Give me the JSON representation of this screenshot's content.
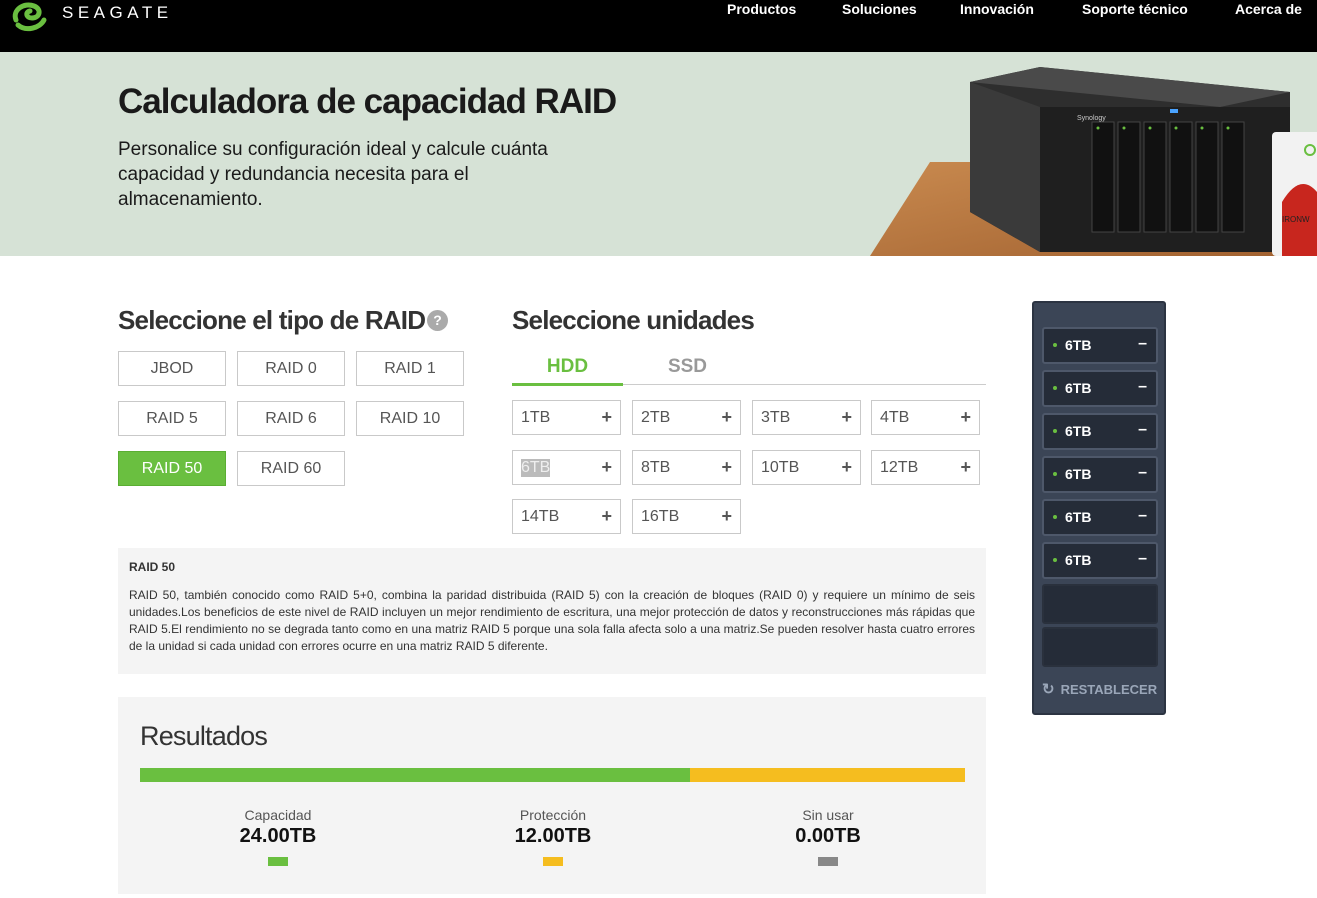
{
  "brand": {
    "logo_text": "SEAGATE",
    "accent_color": "#6abf40"
  },
  "nav": {
    "items": [
      "Productos",
      "Soluciones",
      "Innovación",
      "Soporte técnico",
      "Acerca de"
    ]
  },
  "hero": {
    "title": "Calculadora de capacidad RAID",
    "subtitle": "Personalice su configuración ideal y calcule cuánta capacidad y redundancia necesita para el almacenamiento.",
    "device_brand": "Synology",
    "drive_brand": "IRONW"
  },
  "raid": {
    "title": "Seleccione el tipo de RAID",
    "help_icon": "question-circle-icon",
    "options": [
      "JBOD",
      "RAID 0",
      "RAID 1",
      "RAID 5",
      "RAID 6",
      "RAID 10",
      "RAID 50",
      "RAID 60"
    ],
    "selected": "RAID 50"
  },
  "drives": {
    "title": "Seleccione unidades",
    "tabs": [
      "HDD",
      "SSD"
    ],
    "active_tab": "HDD",
    "sizes": [
      "1TB",
      "2TB",
      "3TB",
      "4TB",
      "6TB",
      "8TB",
      "10TB",
      "12TB",
      "14TB",
      "16TB"
    ],
    "add_symbol": "+"
  },
  "description": {
    "title": "RAID 50",
    "body": "RAID 50, también conocido como RAID 5+0, combina la paridad distribuida (RAID 5) con la creación de bloques (RAID 0) y requiere un mínimo de seis unidades.Los beneficios de este nivel de RAID incluyen un mejor rendimiento de escritura, una mejor protección de datos y reconstrucciones más rápidas que RAID 5.El rendimiento no se degrada tanto como en una matriz RAID 5 porque una sola falla afecta solo a una matriz.Se pueden resolver hasta cuatro errores de la unidad si cada unidad con errores ocurre en una matriz RAID 5 diferente."
  },
  "results": {
    "title": "Resultados",
    "capacity": {
      "label": "Capacidad",
      "value": "24.00TB",
      "color": "#6abf40"
    },
    "protection": {
      "label": "Protección",
      "value": "12.00TB",
      "color": "#f5bd1f"
    },
    "unused": {
      "label": "Sin usar",
      "value": "0.00TB",
      "color": "#888888"
    },
    "bar_fractions": {
      "capacity": 0.667,
      "protection": 0.333,
      "unused": 0.0
    }
  },
  "nas": {
    "slots": [
      {
        "size": "6TB",
        "remove": "–"
      },
      {
        "size": "6TB",
        "remove": "–"
      },
      {
        "size": "6TB",
        "remove": "–"
      },
      {
        "size": "6TB",
        "remove": "–"
      },
      {
        "size": "6TB",
        "remove": "–"
      },
      {
        "size": "6TB",
        "remove": "–"
      }
    ],
    "empty_slots": 2,
    "reset_label": "RESTABLECER",
    "reset_icon": "refresh-icon"
  }
}
